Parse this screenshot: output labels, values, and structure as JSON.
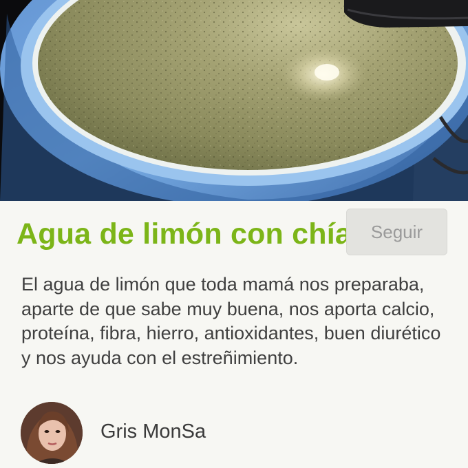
{
  "recipe": {
    "title": "Agua de limón con chía",
    "description": "El agua de limón que toda mamá nos preparaba, aparte de que sabe muy buena, nos aporta calcio, proteína, fibra, hierro, antioxidantes, buen diurético y nos ayuda con el estreñimiento."
  },
  "author": {
    "name": "Gris MonSa",
    "follow_label": "Seguir"
  },
  "colors": {
    "title_green": "#7cb518",
    "follow_button_bg": "#e3e3df",
    "follow_button_text": "#9a9a9a",
    "card_bg": "#f7f7f3"
  },
  "icons": {
    "hero": "recipe-photo-bowl-lemon-chia-drink",
    "avatar": "author-avatar-photo"
  }
}
